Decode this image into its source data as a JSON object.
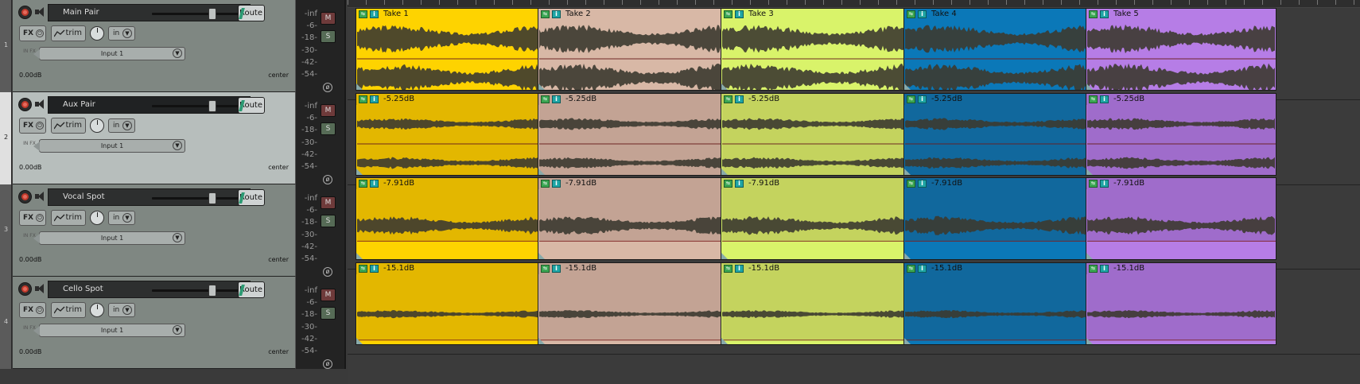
{
  "tracks": [
    {
      "number": "1",
      "name": "Main Pair",
      "route": "Route",
      "fx": "FX",
      "trim": "trim",
      "in": "in",
      "input": "Input 1",
      "input_fx": "IN FX",
      "vol": "0.00dB",
      "pan": "center",
      "fader": 0.62,
      "selected": false
    },
    {
      "number": "2",
      "name": "Aux Pair",
      "route": "Route",
      "fx": "FX",
      "trim": "trim",
      "in": "in",
      "input": "Input 1",
      "input_fx": "IN FX",
      "vol": "0.00dB",
      "pan": "center",
      "fader": 0.62,
      "selected": true
    },
    {
      "number": "3",
      "name": "Vocal Spot",
      "route": "Route",
      "fx": "FX",
      "trim": "trim",
      "in": "in",
      "input": "Input 1",
      "input_fx": "IN FX",
      "vol": "0.00dB",
      "pan": "center",
      "fader": 0.62,
      "selected": false
    },
    {
      "number": "4",
      "name": "Cello Spot",
      "route": "Route",
      "fx": "FX",
      "trim": "trim",
      "in": "in",
      "input": "Input 1",
      "input_fx": "IN FX",
      "vol": "0.00dB",
      "pan": "center",
      "fader": 0.62,
      "selected": false
    }
  ],
  "meter": {
    "scale": [
      "-inf",
      "-6-",
      "-18-",
      "-30-",
      "-42-",
      "-54-"
    ],
    "mute": "M",
    "solo": "S",
    "phase": "ø"
  },
  "item_icons": {
    "env": "⇆",
    "info": "i"
  },
  "lanes": [
    {
      "labels": [
        "Take 1",
        "Take 2",
        "Take 3",
        "Take 4",
        "Take 5"
      ],
      "amp": 0.85,
      "style": "stereo"
    },
    {
      "labels": [
        "-5.25dB",
        "-5.25dB",
        "-5.25dB",
        "-5.25dB",
        "-5.25dB"
      ],
      "amp": 0.35,
      "style": "stereo"
    },
    {
      "labels": [
        "-7.91dB",
        "-7.91dB",
        "-7.91dB",
        "-7.91dB",
        "-7.91dB"
      ],
      "amp": 0.28,
      "style": "mono"
    },
    {
      "labels": [
        "-15.1dB",
        "-15.1dB",
        "-15.1dB",
        "-15.1dB",
        "-15.1dB"
      ],
      "amp": 0.12,
      "style": "mono"
    }
  ],
  "item_colors": [
    "#fed300",
    "#d8b8a6",
    "#d9f36a",
    "#0b78b8",
    "#b67de6"
  ],
  "item_colors_dim": [
    "#e3b700",
    "#c3a394",
    "#c4d35e",
    "#11689d",
    "#9f6ccb"
  ]
}
